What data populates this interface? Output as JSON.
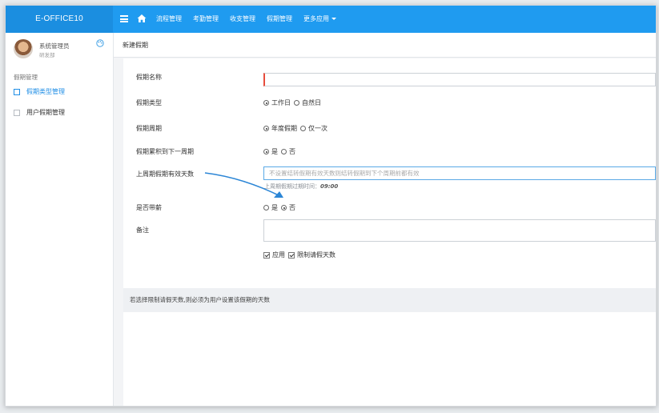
{
  "app": {
    "brand": "E-OFFICE10"
  },
  "topnav": {
    "items": [
      "流程管理",
      "考勤管理",
      "收支管理",
      "假期管理",
      "更多应用"
    ]
  },
  "sidebar": {
    "user_name": "系统管理员",
    "user_dept": "研发部",
    "group_title": "假期管理",
    "items": [
      {
        "label": "假期类型管理",
        "active": true
      },
      {
        "label": "用户假期管理",
        "active": false
      }
    ]
  },
  "breadcrumb": {
    "title": "新建假期"
  },
  "form": {
    "name_label": "假期名称",
    "name_value": "",
    "type_label": "假期类型",
    "type_options": [
      "工作日",
      "自然日"
    ],
    "type_selected": "工作日",
    "cycle_label": "假期周期",
    "cycle_options": [
      "年度假期",
      "仅一次"
    ],
    "cycle_selected": "年度假期",
    "carry_label": "假期累积到下一周期",
    "carry_options": [
      "是",
      "否"
    ],
    "carry_selected": "是",
    "valid_days_label": "上周期假期有效天数",
    "valid_days_placeholder": "不设置结转假期有效天数则结转假期到下个周期前都有效",
    "expire_hint_label": "上周期假期过期时间：",
    "expire_hint_time": "09:00",
    "paid_label": "是否带薪",
    "paid_options": [
      "是",
      "否"
    ],
    "paid_selected": "否",
    "remark_label": "备注",
    "apply_label": "应用",
    "limit_label": "限制请假天数"
  },
  "notice": {
    "text": "若选择限制请假天数,则必须为用户设置该假期的天数"
  },
  "colors": {
    "topbar": "#1f9bf0",
    "brand_bg": "#1b8ee0",
    "active": "#1f8ee6",
    "arrow": "#2c86d6",
    "required": "#e74c3c"
  }
}
